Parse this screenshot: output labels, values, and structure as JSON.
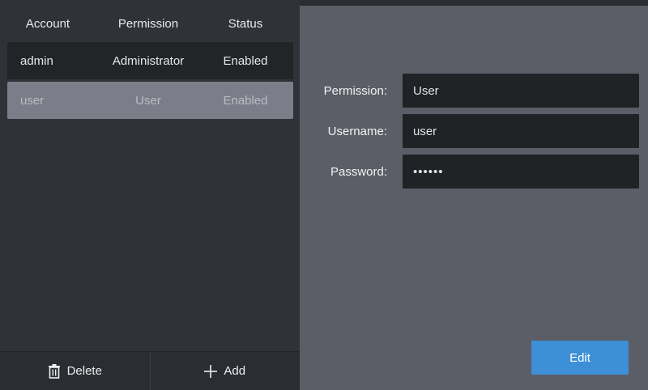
{
  "table": {
    "headers": {
      "account": "Account",
      "permission": "Permission",
      "status": "Status"
    },
    "rows": [
      {
        "account": "admin",
        "permission": "Administrator",
        "status": "Enabled"
      },
      {
        "account": "user",
        "permission": "User",
        "status": "Enabled"
      }
    ]
  },
  "actions": {
    "delete_label": "Delete",
    "add_label": "Add"
  },
  "form": {
    "permission_label": "Permission:",
    "permission_value": "User",
    "username_label": "Username:",
    "username_value": "user",
    "password_label": "Password:",
    "password_value": "••••••"
  },
  "edit_label": "Edit",
  "icons": {
    "delete": "trash-icon",
    "add": "plus-icon"
  },
  "colors": {
    "accent": "#3d8fd6",
    "selected_row": "#7b7e88",
    "panel": "#5b5e67"
  }
}
